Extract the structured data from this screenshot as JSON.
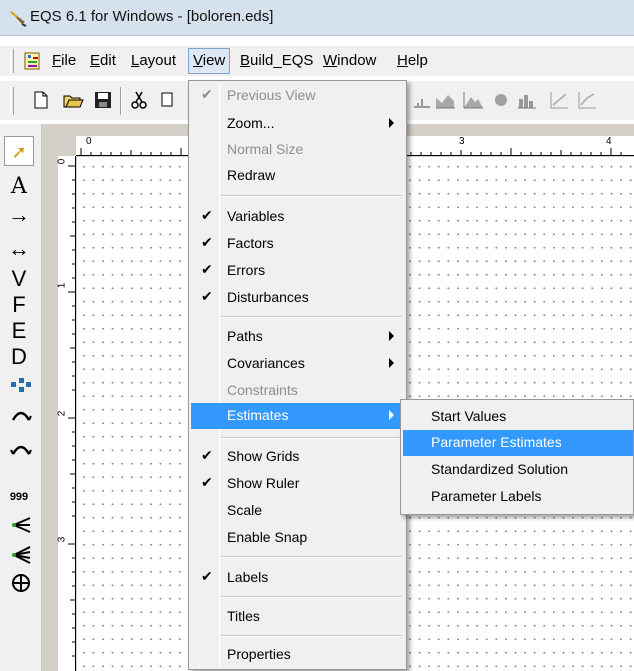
{
  "window": {
    "title": "EQS 6.1 for Windows - [boloren.eds]"
  },
  "menubar": {
    "items": [
      {
        "label": "File",
        "accel": "F",
        "rest": "ile"
      },
      {
        "label": "Edit",
        "accel": "E",
        "rest": "dit"
      },
      {
        "label": "Layout",
        "accel": "L",
        "rest": "ayout"
      },
      {
        "label": "View",
        "accel": "V",
        "rest": "iew"
      },
      {
        "label": "Build_EQS",
        "accel": "B",
        "rest": "uild_EQS"
      },
      {
        "label": "Window",
        "accel": "W",
        "rest": "indow"
      },
      {
        "label": "Help",
        "accel": "H",
        "rest": "elp"
      }
    ],
    "active": "View"
  },
  "toolbar": {
    "icons": [
      "new-file-icon",
      "open-folder-icon",
      "save-icon",
      "cut-icon",
      "area-chart-icon",
      "mountain-chart-icon",
      "pie-icon",
      "bar-chart-icon",
      "line-chart-icon",
      "line-chart-2-icon"
    ]
  },
  "palette": {
    "tools": [
      {
        "name": "pointer-tool",
        "glyph": "➚"
      },
      {
        "name": "text-tool",
        "glyph": "A"
      },
      {
        "name": "path-tool",
        "glyph": "→"
      },
      {
        "name": "covariance-tool",
        "glyph": "↔"
      },
      {
        "name": "variable-tool",
        "glyph": "V"
      },
      {
        "name": "factor-tool",
        "glyph": "F"
      },
      {
        "name": "error-tool",
        "glyph": "E"
      },
      {
        "name": "disturbance-tool",
        "glyph": "D"
      },
      {
        "name": "group-tool",
        "glyph": "⚲"
      },
      {
        "name": "arc-up-tool",
        "glyph": "⌒"
      },
      {
        "name": "arc-down-tool",
        "glyph": "⌒"
      },
      {
        "name": "number-tool",
        "glyph": "999"
      },
      {
        "name": "multi-path-tool",
        "glyph": "⋞"
      },
      {
        "name": "multi-factor-tool",
        "glyph": "⋞"
      },
      {
        "name": "crosshair-tool",
        "glyph": "⊕"
      }
    ]
  },
  "rulers": {
    "top": [
      "0",
      "3",
      "4"
    ],
    "left": [
      "0",
      "1",
      "2",
      "3"
    ]
  },
  "view_menu": {
    "items": [
      {
        "label": "Previous View",
        "checked": true,
        "disabled": true,
        "submenu": false
      },
      {
        "label": "Zoom...",
        "checked": false,
        "disabled": false,
        "submenu": true
      },
      {
        "label": "Normal Size",
        "checked": false,
        "disabled": true,
        "submenu": false
      },
      {
        "label": "Redraw",
        "checked": false,
        "disabled": false,
        "submenu": false
      },
      {
        "label": "Variables",
        "checked": true,
        "disabled": false,
        "submenu": false
      },
      {
        "label": "Factors",
        "checked": true,
        "disabled": false,
        "submenu": false
      },
      {
        "label": "Errors",
        "checked": true,
        "disabled": false,
        "submenu": false
      },
      {
        "label": "Disturbances",
        "checked": true,
        "disabled": false,
        "submenu": false
      },
      {
        "label": "Paths",
        "checked": false,
        "disabled": false,
        "submenu": true
      },
      {
        "label": "Covariances",
        "checked": false,
        "disabled": false,
        "submenu": true
      },
      {
        "label": "Constraints",
        "checked": false,
        "disabled": true,
        "submenu": false
      },
      {
        "label": "Estimates",
        "checked": false,
        "disabled": false,
        "submenu": true,
        "highlighted": true
      },
      {
        "label": "Show Grids",
        "checked": true,
        "disabled": false,
        "submenu": false
      },
      {
        "label": "Show Ruler",
        "checked": true,
        "disabled": false,
        "submenu": false
      },
      {
        "label": "Scale",
        "checked": false,
        "disabled": false,
        "submenu": false
      },
      {
        "label": "Enable Snap",
        "checked": false,
        "disabled": false,
        "submenu": false
      },
      {
        "label": "Labels",
        "checked": true,
        "disabled": false,
        "submenu": false
      },
      {
        "label": "Titles",
        "checked": false,
        "disabled": false,
        "submenu": false
      },
      {
        "label": "Properties",
        "checked": false,
        "disabled": false,
        "submenu": false
      }
    ],
    "check_glyph": "✔"
  },
  "estimates_submenu": {
    "items": [
      {
        "label": "Start Values",
        "highlighted": false
      },
      {
        "label": "Parameter Estimates",
        "highlighted": true
      },
      {
        "label": "Standardized Solution",
        "highlighted": false
      },
      {
        "label": "Parameter Labels",
        "highlighted": false
      }
    ]
  },
  "colors": {
    "highlight": "#3399ff",
    "menu_bg": "#f0f0f0",
    "titlebar_bg": "#d6e1ee"
  }
}
